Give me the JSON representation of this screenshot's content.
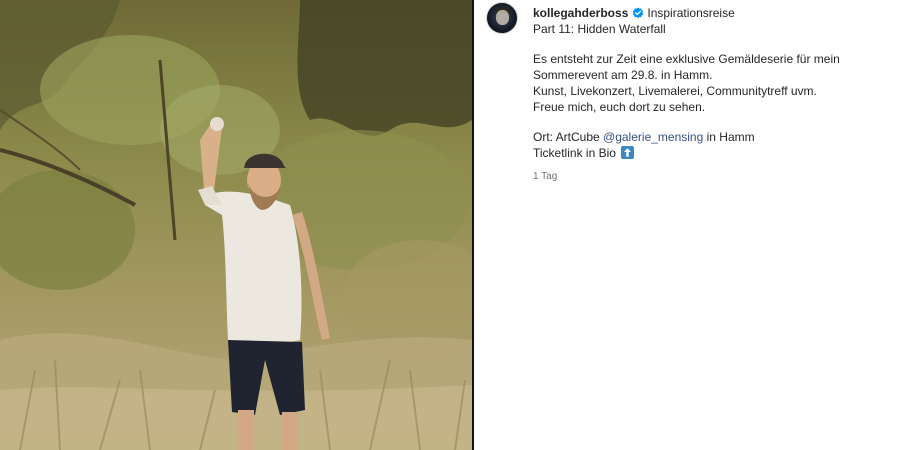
{
  "post": {
    "media_description_icon": "photo",
    "author": {
      "username": "kollegahderboss",
      "verified_icon": "verified-badge-icon",
      "location": "Inspirationsreise"
    },
    "caption": {
      "title": "Part 11: Hidden Waterfall",
      "lines": [
        "Es entsteht zur Zeit eine exklusive Gemäldeserie für mein",
        "Sommerevent am 29.8. in Hamm.",
        "Kunst, Livekonzert, Livemalerei, Communitytreff uvm.",
        "Freue mich, euch dort zu sehen."
      ],
      "ort_prefix": "Ort: ArtCube ",
      "mention": "@galerie_mensing",
      "ort_suffix": " in Hamm",
      "ticket_text": "Ticketlink in Bio ",
      "ticket_icon": "up-arrow-emoji-icon"
    },
    "timestamp": "1 Tag"
  },
  "colors": {
    "mention": "#385185",
    "verified": "#0095f6",
    "timestamp": "#737373"
  }
}
